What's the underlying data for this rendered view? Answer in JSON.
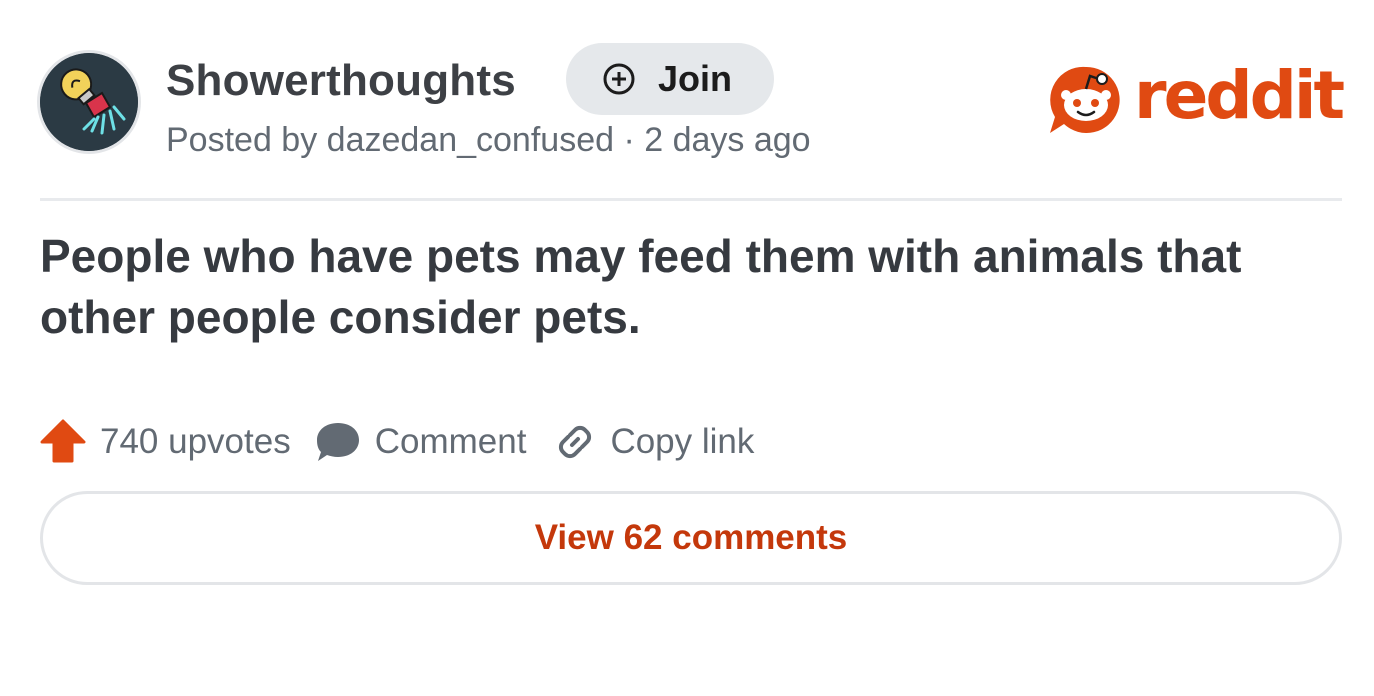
{
  "post": {
    "subreddit": "Showerthoughts",
    "join_label": "Join",
    "posted_by": "Posted by dazedan_confused · 2 days ago",
    "title": "People who have pets may feed them with animals that other people consider pets.",
    "upvotes_label": "740 upvotes",
    "comment_label": "Comment",
    "copy_link_label": "Copy link",
    "view_comments_label": "View 62 comments"
  },
  "brand": {
    "logo_text": "reddit",
    "color": "#e04a12",
    "icon": "reddit-snoo-icon"
  },
  "colors": {
    "upvote": "#e04a12",
    "link_text": "#c4380b",
    "muted_text": "#626a73"
  },
  "icons": {
    "subreddit_avatar": "lightbulb-shower-icon",
    "join": "plus-circle-icon",
    "upvote": "upvote-arrow-icon",
    "comment": "speech-bubble-icon",
    "copy_link": "chain-link-icon"
  }
}
